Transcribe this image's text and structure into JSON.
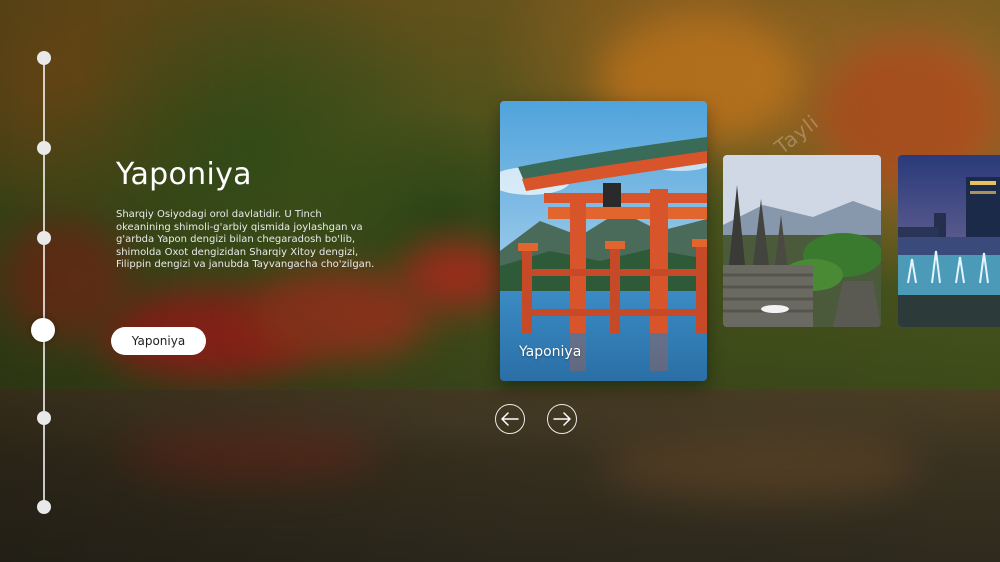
{
  "country": {
    "title": "Yaponiya",
    "description": "Sharqiy Osiyodagi orol davlatidir. U Tinch okeanining shimoli-g'arbiy qismida joylashgan va g'arbda Yapon dengizi bilan chegaradosh bo'lib, shimolda Oxot dengizidan Sharqiy Xitoy dengizi, Filippin dengizi va janubda Tayvangacha cho'zilgan.",
    "button_label": "Yaponiya"
  },
  "timeline": {
    "count": 6,
    "active_index": 3
  },
  "cards": [
    {
      "label": "Yaponiya",
      "scene": "torii-gate"
    },
    {
      "label": "",
      "scene": "temple"
    },
    {
      "label": "",
      "scene": "city-night"
    }
  ],
  "nav": {
    "prev_icon": "arrow-left-icon",
    "next_icon": "arrow-right-icon"
  },
  "watermark": "Tayli",
  "colors": {
    "accent": "#ffffff",
    "sea": "#3d8fc4",
    "torii": "#d8542a"
  }
}
